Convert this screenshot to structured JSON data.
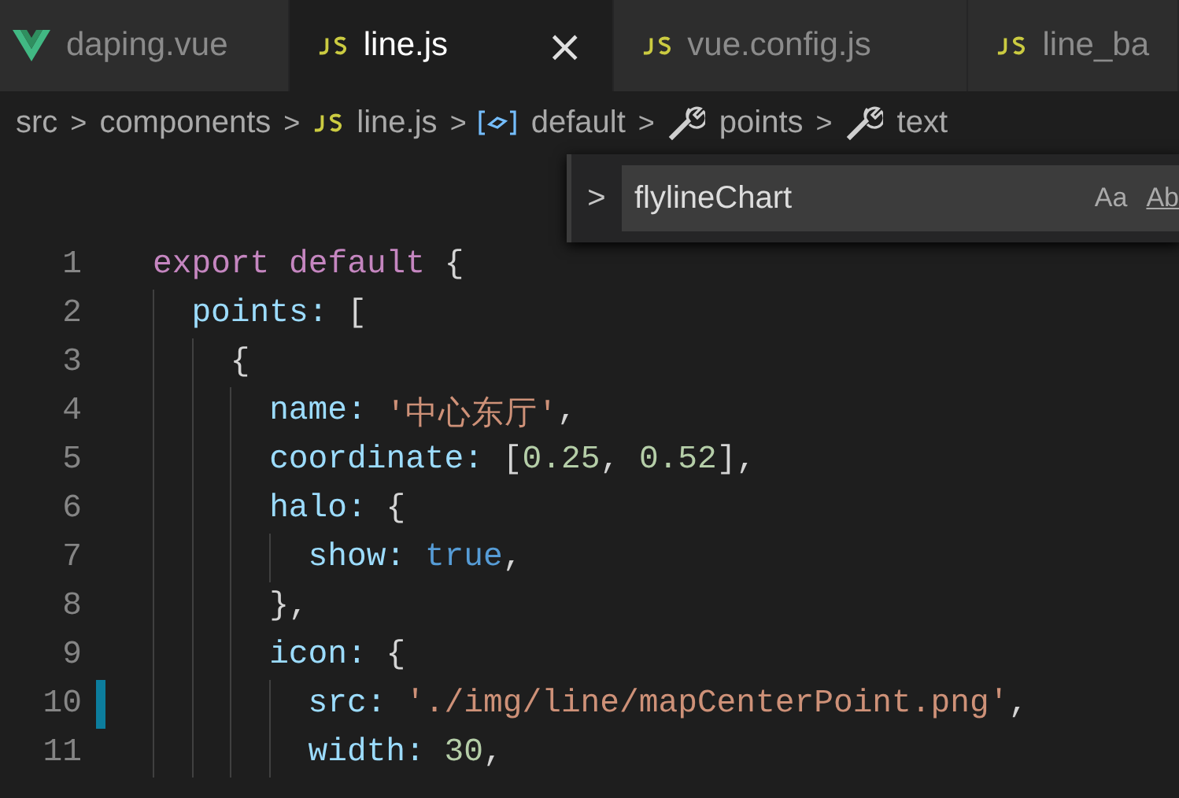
{
  "tabs": [
    {
      "label": "daping.vue",
      "kind": "vue",
      "selected": false
    },
    {
      "label": "line.js",
      "kind": "js",
      "selected": true,
      "close": "×"
    },
    {
      "label": "vue.config.js",
      "kind": "js",
      "selected": false
    },
    {
      "label": "line_ba",
      "kind": "js",
      "selected": false
    }
  ],
  "breadcrumb": [
    {
      "label": "src",
      "kind": "folder"
    },
    {
      "label": "components",
      "kind": "folder"
    },
    {
      "label": "line.js",
      "kind": "js"
    },
    {
      "label": "default",
      "kind": "object"
    },
    {
      "label": "points",
      "kind": "property"
    },
    {
      "label": "text",
      "kind": "property"
    }
  ],
  "breadcrumb_separator": ">",
  "find_widget": {
    "toggle": ">",
    "value": "flylineChart",
    "options": [
      "Aa",
      "Ab"
    ]
  },
  "editor": {
    "lines": [
      {
        "number": "1",
        "modified": false,
        "tokens": [
          {
            "kind": "keyword",
            "text": "export default"
          },
          {
            "kind": "punct",
            "text": "{"
          }
        ]
      },
      {
        "number": "2",
        "guides": [
          {
            "highlighted": false
          }
        ],
        "modified": false,
        "tokens": [
          {
            "kind": "prop",
            "text": "points:"
          },
          {
            "kind": "punct",
            "text": "["
          }
        ]
      },
      {
        "number": "3",
        "guides": [
          {
            "highlighted": false
          },
          {
            "highlighted": false
          }
        ],
        "modified": false,
        "tokens": [
          {
            "kind": "punct",
            "text": "{"
          }
        ]
      },
      {
        "number": "4",
        "guides": [
          {
            "highlighted": false
          },
          {
            "highlighted": false
          },
          {
            "highlighted": false
          }
        ],
        "modified": false,
        "tokens": [
          {
            "kind": "prop",
            "text": "name:"
          },
          {
            "kind": "string",
            "text": "'中心东厅'"
          },
          {
            "kind": "punct",
            "text": ","
          }
        ]
      },
      {
        "number": "5",
        "guides": [
          {
            "highlighted": false
          },
          {
            "highlighted": false
          },
          {
            "highlighted": false
          }
        ],
        "modified": false,
        "tokens": [
          {
            "kind": "prop",
            "text": "coordinate:"
          },
          {
            "kind": "punct",
            "text": "["
          },
          {
            "kind": "number",
            "text": "0.25"
          },
          {
            "kind": "punct",
            "text": ","
          },
          {
            "kind": "number",
            "text": "0.52"
          },
          {
            "kind": "punct",
            "text": "],"
          }
        ]
      },
      {
        "number": "6",
        "guides": [
          {
            "highlighted": false
          },
          {
            "highlighted": false
          },
          {
            "highlighted": false
          }
        ],
        "modified": false,
        "tokens": [
          {
            "kind": "prop",
            "text": "halo:"
          },
          {
            "kind": "punct",
            "text": "{"
          }
        ]
      },
      {
        "number": "7",
        "guides": [
          {
            "highlighted": false
          },
          {
            "highlighted": false
          },
          {
            "highlighted": false
          },
          {
            "highlighted": false
          }
        ],
        "modified": false,
        "tokens": [
          {
            "kind": "prop",
            "text": "show:"
          },
          {
            "kind": "bool",
            "text": "true"
          },
          {
            "kind": "punct",
            "text": ","
          }
        ]
      },
      {
        "number": "8",
        "guides": [
          {
            "highlighted": false
          },
          {
            "highlighted": false
          },
          {
            "highlighted": false
          }
        ],
        "modified": false,
        "tokens": [
          {
            "kind": "punct",
            "text": "},"
          }
        ]
      },
      {
        "number": "9",
        "guides": [
          {
            "highlighted": false
          },
          {
            "highlighted": false
          },
          {
            "highlighted": false
          }
        ],
        "modified": false,
        "tokens": [
          {
            "kind": "prop",
            "text": "icon:"
          },
          {
            "kind": "punct",
            "text": "{"
          }
        ]
      },
      {
        "number": "10",
        "guides": [
          {
            "highlighted": false
          },
          {
            "highlighted": false
          },
          {
            "highlighted": false
          },
          {
            "highlighted": false
          }
        ],
        "modified": true,
        "tokens": [
          {
            "kind": "prop",
            "text": "src:"
          },
          {
            "kind": "string",
            "text": "'./img/line/mapCenterPoint.png'"
          },
          {
            "kind": "punct",
            "text": ","
          }
        ]
      },
      {
        "number": "11",
        "guides": [
          {
            "highlighted": false
          },
          {
            "highlighted": false
          },
          {
            "highlighted": false
          },
          {
            "highlighted": false
          }
        ],
        "modified": false,
        "tokens": [
          {
            "kind": "prop",
            "text": "width:"
          },
          {
            "kind": "number",
            "text": "30"
          },
          {
            "kind": "punct",
            "text": ","
          }
        ]
      }
    ]
  }
}
